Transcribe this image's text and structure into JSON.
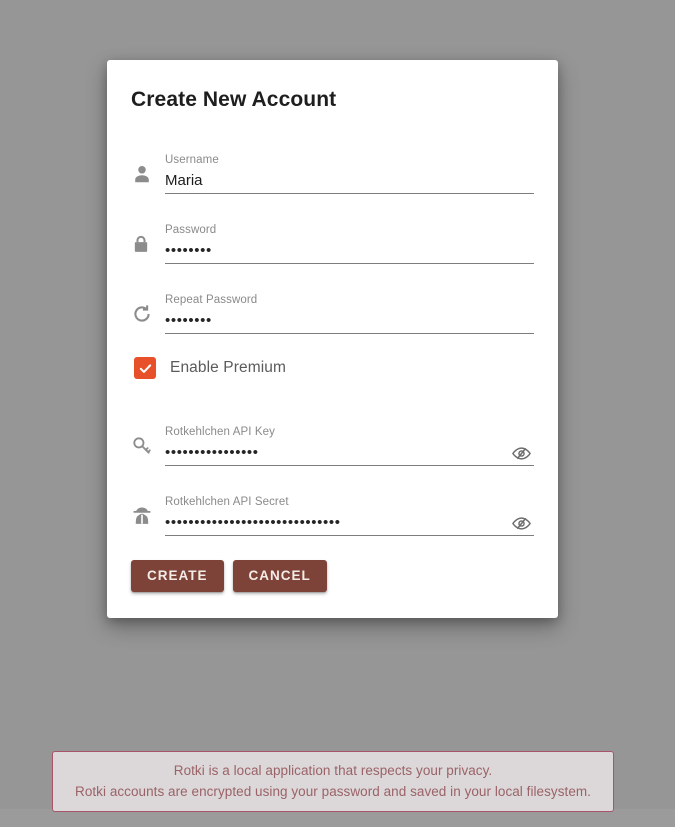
{
  "window": {
    "background_color": "#969696"
  },
  "dialog": {
    "title": "Create New Account",
    "fields": [
      {
        "icon": "account-icon",
        "label": "Username",
        "value": "Maria",
        "masked": false,
        "append_icon": null
      },
      {
        "icon": "lock-icon",
        "label": "Password",
        "value": "••••••••",
        "masked": true,
        "append_icon": null
      },
      {
        "icon": "repeat-icon",
        "label": "Repeat Password",
        "value": "••••••••",
        "masked": true,
        "append_icon": null
      }
    ],
    "premium": {
      "label": "Enable Premium",
      "checked": true,
      "accent_color": "#e8502a"
    },
    "premium_fields": [
      {
        "icon": "key-icon",
        "label": "Rotkehlchen API Key",
        "value": "••••••••••••••••",
        "masked": true,
        "append_icon": "eye-off-icon"
      },
      {
        "icon": "spy-icon",
        "label": "Rotkehlchen API Secret",
        "value": "••••••••••••••••••••••••••••••",
        "masked": true,
        "append_icon": "eye-off-icon"
      }
    ],
    "actions": {
      "create_label": "CREATE",
      "cancel_label": "CANCEL",
      "button_color": "#7e4338"
    }
  },
  "privacy_banner": {
    "line1": "Rotki is a local application that respects your privacy.",
    "line2": "Rotki accounts are encrypted using your password and saved in your local filesystem.",
    "text_color": "#9a6368",
    "border_color": "#a8556a"
  }
}
